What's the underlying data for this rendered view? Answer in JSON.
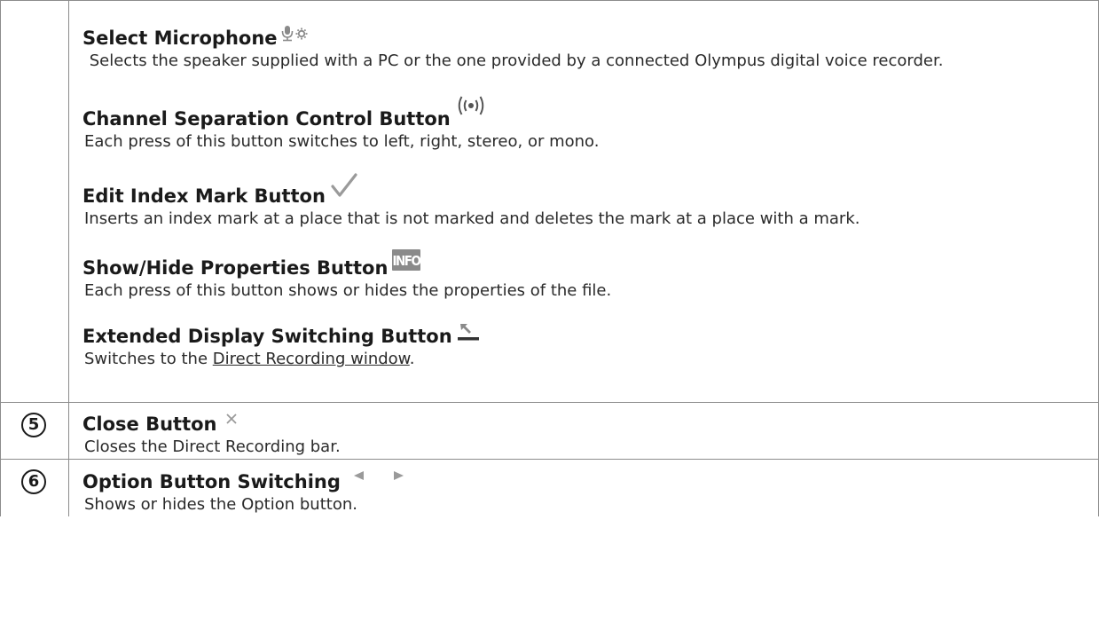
{
  "rows": [
    {
      "number": "",
      "items": [
        {
          "title": "Select Microphone",
          "icon": "microphone-settings-icon",
          "text": " Selects the speaker supplied with a PC or the one provided by a connected Olympus digital voice recorder."
        },
        {
          "title": "Channel Separation Control Button",
          "icon": "channel-separation-icon",
          "text": "Each press of this button switches to left, right, stereo, or mono."
        },
        {
          "title": "Edit Index Mark Button",
          "icon": "checkmark-icon",
          "text": "Inserts an index mark at a place that is not marked and deletes the mark at a place with a mark."
        },
        {
          "title": "Show/Hide Properties Button",
          "icon": "info-icon",
          "icon_text": "INFO",
          "text": "Each press of this button shows or hides the properties of the file."
        },
        {
          "title": "Extended Display Switching Button",
          "icon": "extended-display-icon",
          "text_prefix": "Switches to the ",
          "link_text": "Direct Recording window",
          "text_suffix": "."
        }
      ]
    },
    {
      "number": "5",
      "items": [
        {
          "title": "Close Button",
          "icon": "close-icon",
          "text": "Closes the Direct Recording bar."
        }
      ]
    },
    {
      "number": "6",
      "items": [
        {
          "title": "Option Button Switching",
          "icon": "left-right-arrows-icon",
          "text": "Shows or hides the Option button."
        }
      ]
    }
  ],
  "colors": {
    "border": "#8c8c8c",
    "text": "#1a1a1a",
    "icon_gray": "#8a8a8a"
  }
}
